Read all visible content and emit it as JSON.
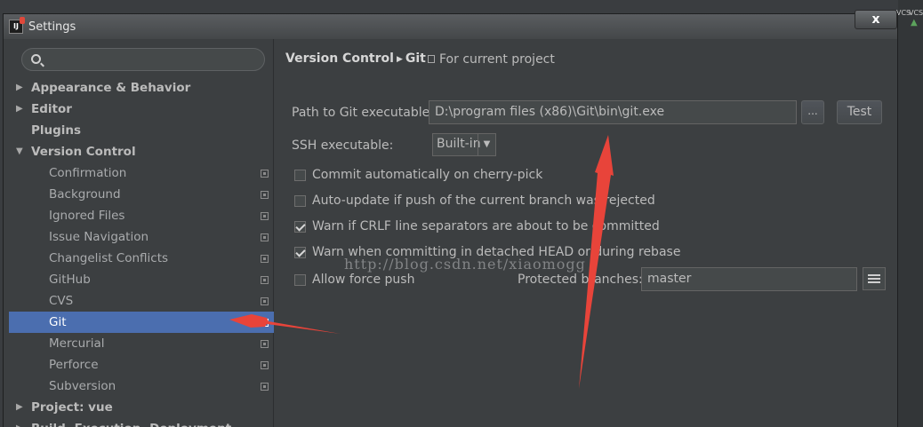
{
  "window": {
    "title": "Settings",
    "close_label": "x",
    "app_icon_text": "IJ"
  },
  "background": {
    "vcs_left": "VCS",
    "vcs_right": "VCS"
  },
  "search": {
    "placeholder": "",
    "value": ""
  },
  "tree": [
    {
      "label": "Appearance & Behavior",
      "level": 0,
      "arrow": "▶",
      "selected": false
    },
    {
      "label": "Editor",
      "level": 0,
      "arrow": "▶",
      "selected": false
    },
    {
      "label": "Plugins",
      "level": 0,
      "arrow": "",
      "selected": false
    },
    {
      "label": "Version Control",
      "level": 0,
      "arrow": "▼",
      "selected": false
    },
    {
      "label": "Confirmation",
      "level": 1,
      "arrow": "",
      "selected": false
    },
    {
      "label": "Background",
      "level": 1,
      "arrow": "",
      "selected": false
    },
    {
      "label": "Ignored Files",
      "level": 1,
      "arrow": "",
      "selected": false
    },
    {
      "label": "Issue Navigation",
      "level": 1,
      "arrow": "",
      "selected": false
    },
    {
      "label": "Changelist Conflicts",
      "level": 1,
      "arrow": "",
      "selected": false
    },
    {
      "label": "GitHub",
      "level": 1,
      "arrow": "",
      "selected": false
    },
    {
      "label": "CVS",
      "level": 1,
      "arrow": "",
      "selected": false
    },
    {
      "label": "Git",
      "level": 1,
      "arrow": "",
      "selected": true
    },
    {
      "label": "Mercurial",
      "level": 1,
      "arrow": "",
      "selected": false
    },
    {
      "label": "Perforce",
      "level": 1,
      "arrow": "",
      "selected": false
    },
    {
      "label": "Subversion",
      "level": 1,
      "arrow": "",
      "selected": false
    },
    {
      "label": "Project: vue",
      "level": 0,
      "arrow": "▶",
      "selected": false
    },
    {
      "label": "Build, Execution, Deployment",
      "level": 0,
      "arrow": "▶",
      "selected": false
    }
  ],
  "breadcrumb": {
    "parent": "Version Control",
    "separator": "▶",
    "current": "Git",
    "scope": "For current project"
  },
  "git": {
    "path_label": "Path to Git executable:",
    "path_value": "D:\\program files (x86)\\Git\\bin\\git.exe",
    "browse_label": "...",
    "test_label": "Test",
    "ssh_label": "SSH executable:",
    "ssh_value": "Built-in",
    "ssh_dropdown": "▼",
    "options": [
      {
        "label": "Commit automatically on cherry-pick",
        "checked": false
      },
      {
        "label": "Auto-update if push of the current branch was rejected",
        "checked": false
      },
      {
        "label": "Warn if CRLF line separators are about to be committed",
        "checked": true
      },
      {
        "label": "Warn when committing in detached HEAD or during rebase",
        "checked": true
      }
    ],
    "force_push_label": "Allow force push",
    "force_push_checked": false,
    "protected_label": "Protected branches:",
    "protected_value": "master"
  },
  "watermark": "http://blog.csdn.net/xiaomogg",
  "colors": {
    "selection": "#4b6eaf",
    "annotation_arrow": "#e8443a"
  },
  "icons": [
    "search-icon",
    "project-scope-icon",
    "dropdown-arrow-icon",
    "list-editor-icon",
    "close-icon"
  ]
}
